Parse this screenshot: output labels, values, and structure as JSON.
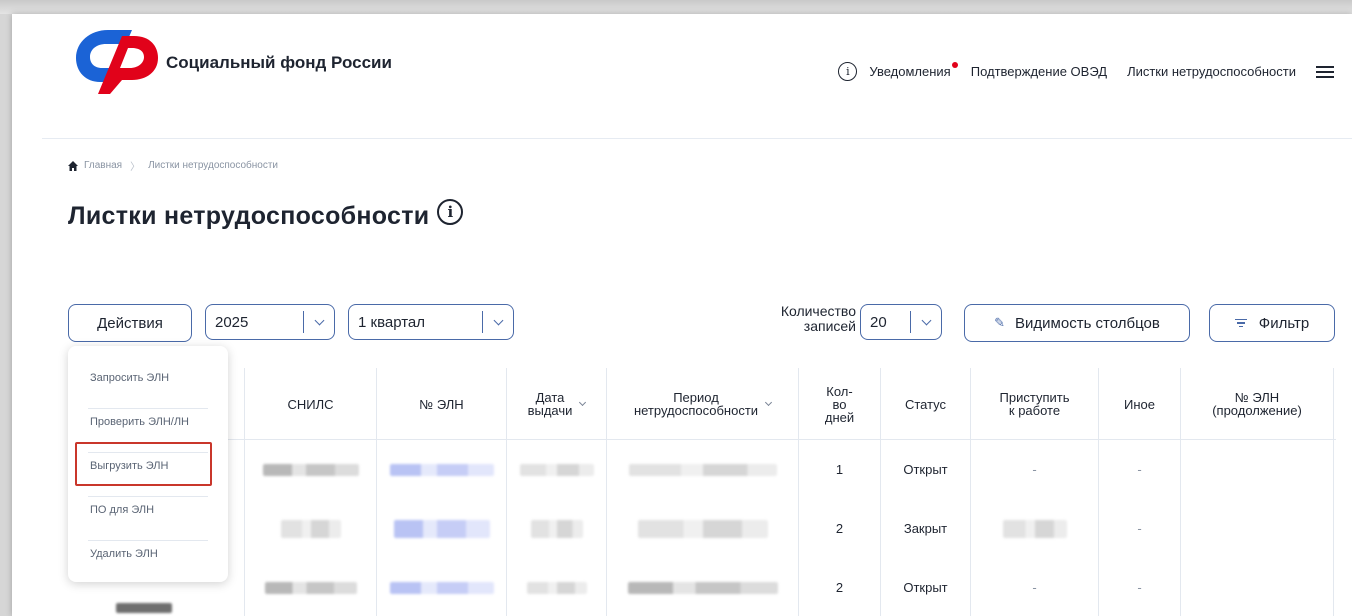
{
  "header": {
    "logo_text": "Социальный фонд России",
    "colors": {
      "logo_blue": "#1b63d6",
      "logo_red": "#e1021a",
      "accent": "#4a6aa8"
    },
    "nav": {
      "info_icon": "info-circle-icon",
      "notifications": "Уведомления",
      "okved": "Подтверждение ОВЭД",
      "sick_leaves": "Листки нетрудоспособности",
      "menu_icon": "hamburger-icon"
    }
  },
  "breadcrumb": {
    "home": "Главная",
    "current": "Листки нетрудоспособности"
  },
  "page_title": "Листки нетрудоспособности",
  "toolbar": {
    "actions_label": "Действия",
    "year_value": "2025",
    "quarter_value": "1 квартал",
    "count_label_line1": "Количество",
    "count_label_line2": "записей",
    "count_value": "20",
    "visibility_label": "Видимость столбцов",
    "filter_label": "Фильтр"
  },
  "actions_menu": {
    "items": [
      "Запросить ЭЛН",
      "Проверить ЭЛН/ЛН",
      "Выгрузить ЭЛН",
      "ПО для ЭЛН",
      "Удалить ЭЛН"
    ],
    "highlighted": "Выгрузить ЭЛН"
  },
  "table": {
    "columns": {
      "snils": "СНИЛС",
      "eln_number": "№ ЭЛН",
      "issue_date_1": "Дата",
      "issue_date_2": "выдачи",
      "period_1": "Период",
      "period_2": "нетрудоспособности",
      "days_1": "Кол-",
      "days_2": "во",
      "days_3": "дней",
      "status": "Статус",
      "start_work_1": "Приступить",
      "start_work_2": "к работе",
      "other": "Иное",
      "continuation_1": "№ ЭЛН",
      "continuation_2": "(продолжение)"
    },
    "rows": [
      {
        "days": "1",
        "status": "Открыт",
        "start_work": "-",
        "other": "-"
      },
      {
        "days": "2",
        "status": "Закрыт",
        "start_work": "",
        "other": "-"
      },
      {
        "days": "2",
        "status": "Открыт",
        "start_work": "-",
        "other": "-"
      }
    ]
  }
}
